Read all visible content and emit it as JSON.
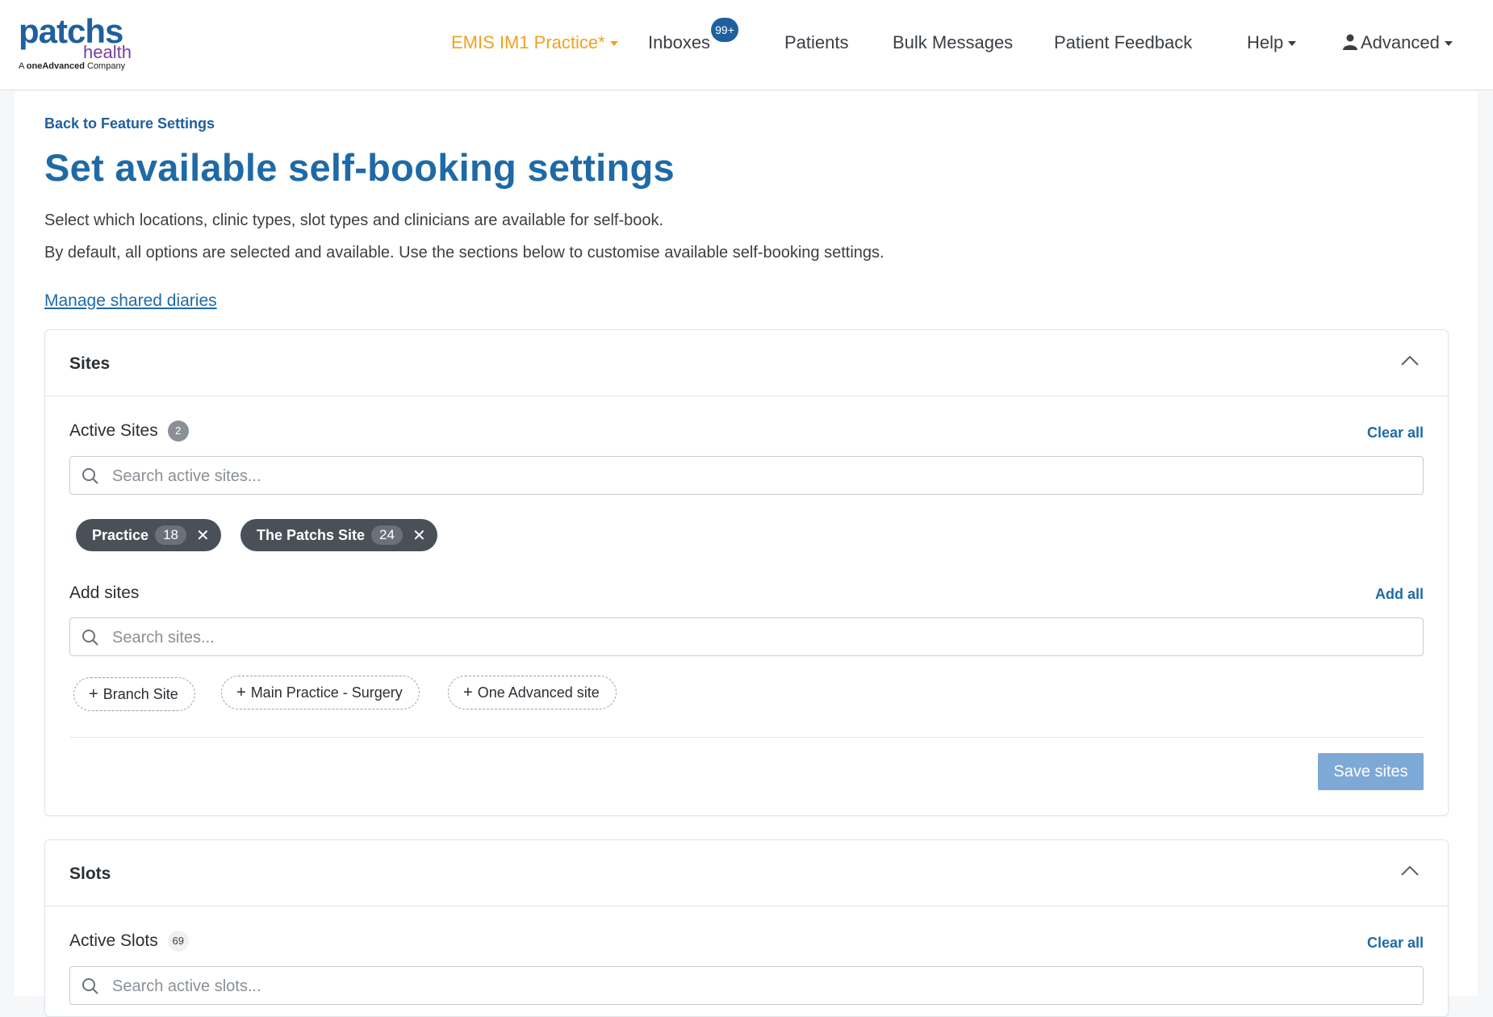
{
  "brand": {
    "logo_word": "patchs",
    "logo_sub": "health",
    "logo_company_prefix": "A ",
    "logo_company_name": "oneAdvanced",
    "logo_company_suffix": " Company"
  },
  "nav": {
    "practice": "EMIS IM1 Practice*",
    "inboxes": "Inboxes",
    "inboxes_badge": "99+",
    "patients": "Patients",
    "bulk_messages": "Bulk Messages",
    "patient_feedback": "Patient Feedback",
    "help": "Help",
    "user": "Advanced"
  },
  "page": {
    "back_link": "Back to Feature Settings",
    "title": "Set available self-booking settings",
    "desc1": "Select which locations, clinic types, slot types and clinicians are available for self-book.",
    "desc2": "By default, all options are selected and available. Use the sections below to customise available self-booking settings.",
    "manage_link": "Manage shared diaries"
  },
  "sites": {
    "title": "Sites",
    "active_label": "Active Sites",
    "active_count": "2",
    "clear_all": "Clear all",
    "active_search_placeholder": "Search active sites...",
    "active_chips": [
      {
        "label": "Practice",
        "count": "18"
      },
      {
        "label": "The Patchs Site",
        "count": "24"
      }
    ],
    "add_label": "Add sites",
    "add_all": "Add all",
    "add_search_placeholder": "Search sites...",
    "add_chips": [
      {
        "label": "Branch Site"
      },
      {
        "label": "Main Practice - Surgery"
      },
      {
        "label": "One Advanced site"
      }
    ],
    "save": "Save sites"
  },
  "slots": {
    "title": "Slots",
    "active_label": "Active Slots",
    "active_count": "69",
    "clear_all": "Clear all",
    "active_search_placeholder": "Search active slots..."
  },
  "colors": {
    "brand_blue": "#1f6aa6",
    "practice_orange": "#f0a020",
    "chip_dark": "#4a5058",
    "save_button": "#7ea9d6"
  }
}
